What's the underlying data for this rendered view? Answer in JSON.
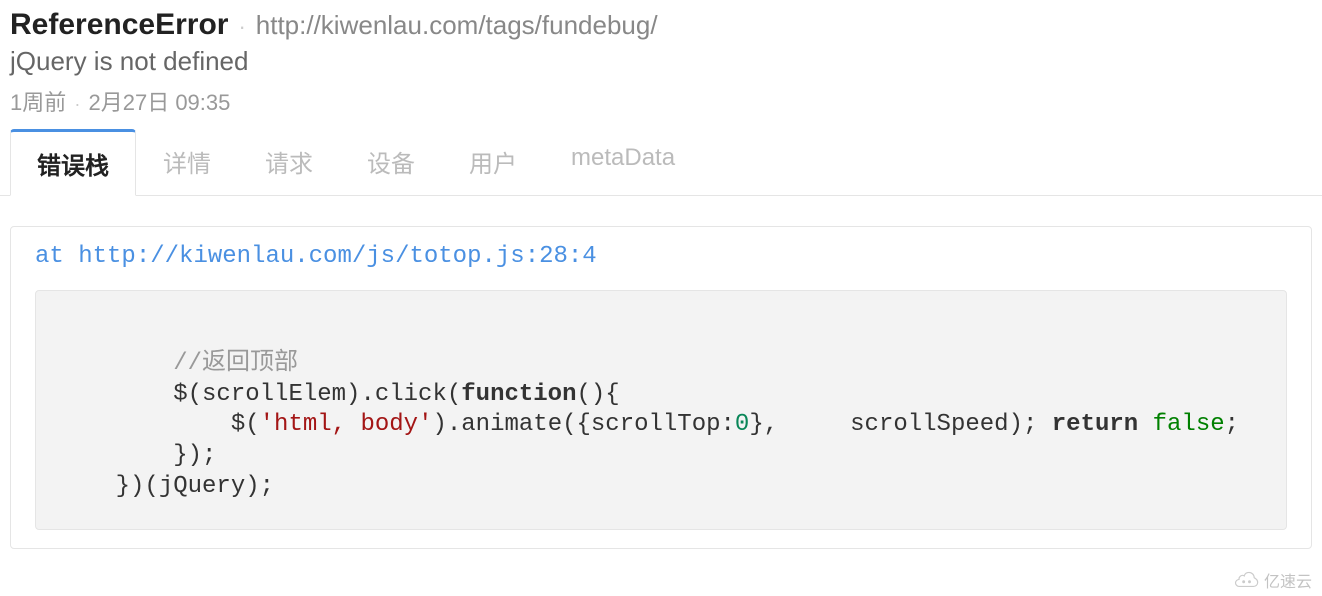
{
  "header": {
    "error_type": "ReferenceError",
    "url": "http://kiwenlau.com/tags/fundebug/",
    "message": "jQuery is not defined",
    "time_ago": "1周前",
    "timestamp": "2月27日 09:35"
  },
  "tabs": [
    {
      "label": "错误栈",
      "active": true
    },
    {
      "label": "详情",
      "active": false
    },
    {
      "label": "请求",
      "active": false
    },
    {
      "label": "设备",
      "active": false
    },
    {
      "label": "用户",
      "active": false
    },
    {
      "label": "metaData",
      "active": false
    }
  ],
  "stack": {
    "link_prefix": "at ",
    "link_text": "http://kiwenlau.com/js/totop.js:28:4",
    "code": {
      "line1_indent": "        ",
      "comment": "//返回顶部",
      "line2_indent": "        ",
      "l2a": "$(scrollElem).click(",
      "kw_function": "function",
      "l2b": "(){",
      "line3_indent": "            ",
      "l3a": "$(",
      "str": "'html, body'",
      "l3b": ").animate({scrollTop:",
      "num0": "0",
      "l3c": "},     scrollSpeed); ",
      "kw_return": "return",
      "sp": " ",
      "bool_false": "false",
      "l3d": ";",
      "line4_indent": "        ",
      "l4": "});",
      "line5_indent": "    ",
      "l5": "})(jQuery);"
    }
  },
  "watermark": {
    "text": "亿速云"
  }
}
